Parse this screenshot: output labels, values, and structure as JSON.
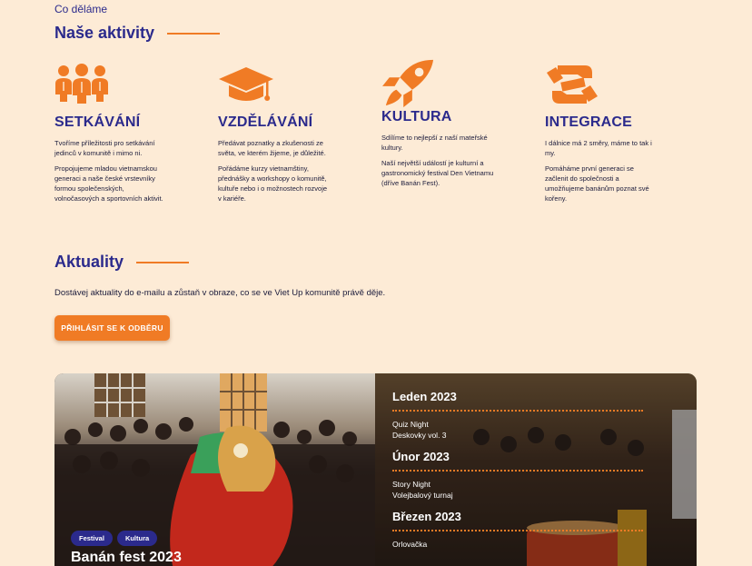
{
  "header": {
    "kicker": "Co děláme",
    "title": "Naše aktivity"
  },
  "activities": [
    {
      "icon": "people-icon",
      "title": "SETKÁVÁNÍ",
      "p1": "Tvoříme příležitosti pro setkávání jedinců v komunitě i mimo ni.",
      "p2": "Propojujeme mladou vietnamskou generaci a naše české vrstevníky formou společenských, volnočasových a sportovních aktivit."
    },
    {
      "icon": "graduation-cap-icon",
      "title": "VZDĚLÁVÁNÍ",
      "p1": "Předávat poznatky a zkušenosti ze světa, ve kterém žijeme, je důležité.",
      "p2": "Pořádáme kurzy vietnamštiny, přednášky a workshopy o komunitě, kultuře nebo i o možnostech rozvoje v kariéře."
    },
    {
      "icon": "rocket-icon",
      "title": "KULTURA",
      "p1": "Sdílíme to nejlepší z naší mateřské kultury.",
      "p2": "Naší největší událostí je kulturní a gastronomický festival Den Vietnamu (dříve Banán Fest)."
    },
    {
      "icon": "handshake-icon",
      "title": "INTEGRACE",
      "p1": "I dálnice má 2 směry, máme to tak i my.",
      "p2": "Pomáháme první generaci se začlenit do společnosti a umožňujeme banánům poznat své kořeny."
    }
  ],
  "news": {
    "title": "Aktuality",
    "text": "Dostávej aktuality do e-mailu a zůstaň v obraze, co se ve Viet Up komunitě právě děje.",
    "button": "PŘIHLÁSIT SE K ODBĚRU"
  },
  "feature": {
    "tags": [
      "Festival",
      "Kultura"
    ],
    "title": "Banán fest 2023"
  },
  "calendar": [
    {
      "month": "Leden 2023",
      "events": [
        "Quiz Night",
        "Deskovky vol. 3"
      ]
    },
    {
      "month": "Únor 2023",
      "events": [
        "Story Night",
        "Volejbalový turnaj"
      ]
    },
    {
      "month": "Březen 2023",
      "events": [
        "Orlovačka"
      ]
    }
  ],
  "colors": {
    "accent": "#f07b25",
    "navy": "#2b2a8c",
    "background": "#fdebd6"
  }
}
